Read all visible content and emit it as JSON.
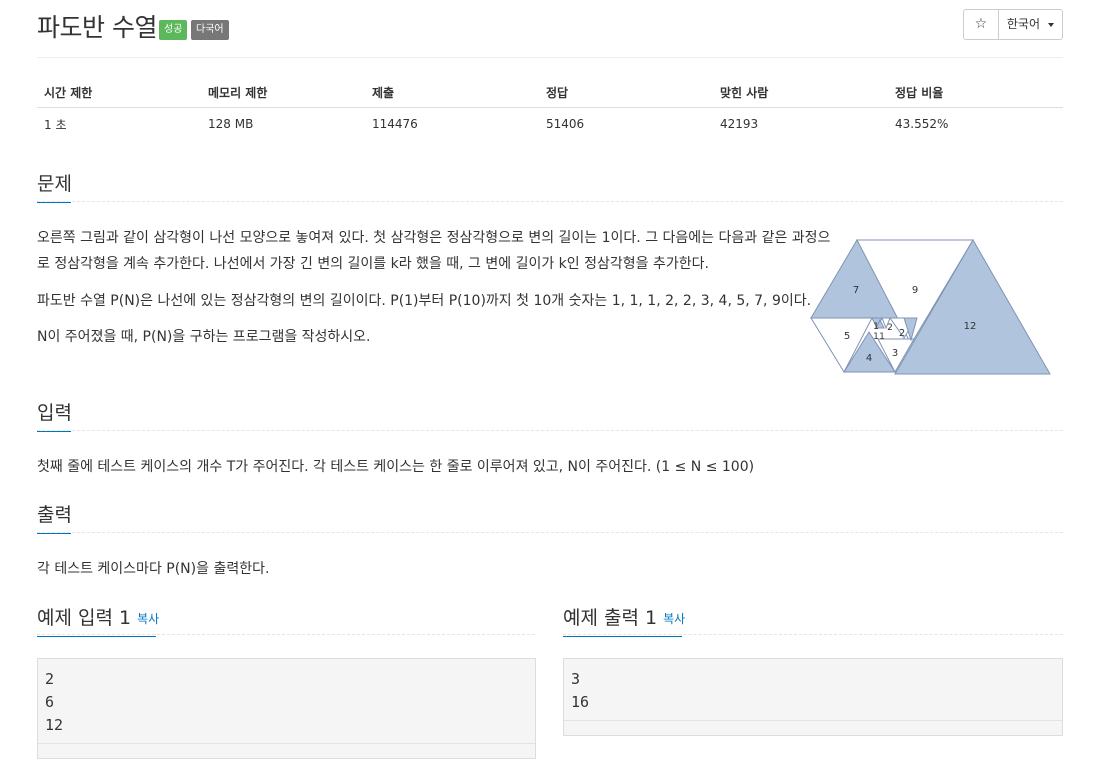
{
  "header": {
    "title": "파도반 수열",
    "badge_success": "성공",
    "badge_multilang": "다국어",
    "star_icon": "☆",
    "language": "한국어"
  },
  "info_table": {
    "headers": [
      "시간 제한",
      "메모리 제한",
      "제출",
      "정답",
      "맞힌 사람",
      "정답 비율"
    ],
    "values": [
      "1 초",
      "128 MB",
      "114476",
      "51406",
      "42193",
      "43.552%"
    ]
  },
  "problem": {
    "heading": "문제",
    "p1_line1": "오른쪽 그림과 같이 삼각형이 나선 모양으로 놓여져 있다. 첫 삼각형은 정삼각형으로 변의 길이는 1이다. 그 다음에는 다음과 같은 과정으",
    "p1_line2": "로 정삼각형을 계속 추가한다. 나선에서 가장 긴 변의 길이를 k라 했을 때, 그 변에 길이가 k인 정삼각형을 추가한다.",
    "p2": "파도반 수열 P(N)은 나선에 있는 정삼각형의 변의 길이이다. P(1)부터 P(10)까지 첫 10개 숫자는 1, 1, 1, 2, 2, 3, 4, 5, 7, 9이다.",
    "p3": "N이 주어졌을 때, P(N)을 구하는 프로그램을 작성하시오.",
    "figure_labels": [
      "7",
      "9",
      "5",
      "1",
      "2",
      "1",
      "1",
      "2",
      "4",
      "3",
      "12"
    ]
  },
  "input": {
    "heading": "입력",
    "text": "첫째 줄에 테스트 케이스의 개수 T가 주어진다. 각 테스트 케이스는 한 줄로 이루어져 있고, N이 주어진다. (1 ≤ N ≤ 100)"
  },
  "output": {
    "heading": "출력",
    "text": "각 테스트 케이스마다 P(N)을 출력한다."
  },
  "sample_input": {
    "heading": "예제 입력 1",
    "copy_label": "복사",
    "lines": [
      "2",
      "6",
      "12"
    ]
  },
  "sample_output": {
    "heading": "예제 출력 1",
    "copy_label": "복사",
    "lines": [
      "3",
      "16"
    ]
  },
  "colors": {
    "accent": "#0076c0",
    "success": "#5cb85c",
    "badge_gray": "#777777",
    "triangle_fill": "#b0c4de"
  }
}
